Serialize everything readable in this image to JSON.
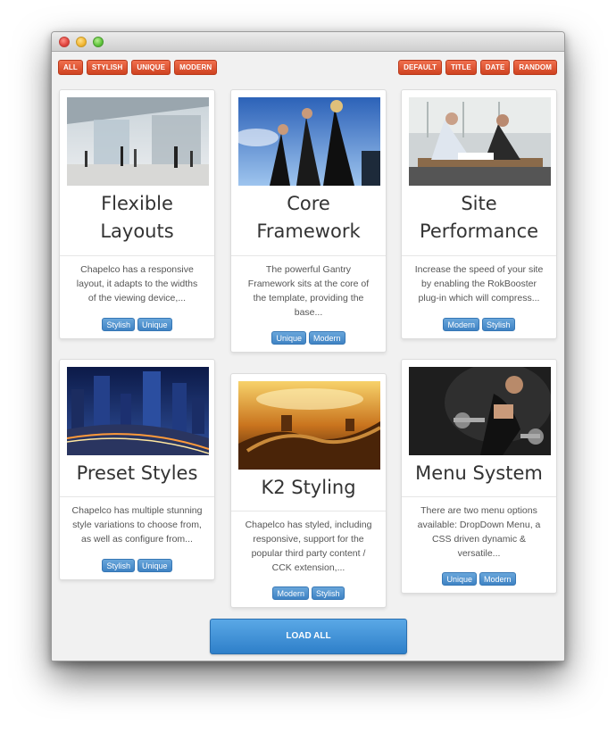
{
  "filters": {
    "categories": [
      "ALL",
      "STYLISH",
      "UNIQUE",
      "MODERN"
    ],
    "sorts": [
      "DEFAULT",
      "TITLE",
      "DATE",
      "RANDOM"
    ]
  },
  "cards": [
    {
      "title": "Flexible Layouts",
      "title_lines": [
        "Flexible",
        "Layouts"
      ],
      "desc_lines": [
        "Chapelco has a responsive",
        "layout, it adapts to the widths",
        "of the viewing device,..."
      ],
      "tags": [
        "Stylish",
        "Unique"
      ],
      "image": "atrium-photo"
    },
    {
      "title": "Core Framework",
      "title_lines": [
        "Core",
        "Framework"
      ],
      "desc_lines": [
        "The powerful Gantry",
        "Framework sits at the core of",
        "the template, providing the",
        "base..."
      ],
      "tags": [
        "Unique",
        "Modern"
      ],
      "image": "business-team-photo"
    },
    {
      "title": "Site Performance",
      "title_lines": [
        "Site",
        "Performance"
      ],
      "desc_lines": [
        "Increase the speed of your site",
        "by enabling the RokBooster",
        "plug-in which will compress..."
      ],
      "tags": [
        "Modern",
        "Stylish"
      ],
      "image": "office-meeting-photo"
    },
    {
      "title": "Preset Styles",
      "title_lines": [
        "Preset Styles"
      ],
      "desc_lines": [
        "Chapelco has multiple stunning",
        "style variations to choose from,",
        "as well as configure from..."
      ],
      "tags": [
        "Stylish",
        "Unique"
      ],
      "image": "city-highway-photo"
    },
    {
      "title": "K2 Styling",
      "title_lines": [
        "K2 Styling"
      ],
      "desc_lines": [
        "Chapelco has styled, including",
        "responsive, support for the",
        "popular third party content /",
        "CCK extension,..."
      ],
      "tags": [
        "Modern",
        "Stylish"
      ],
      "image": "great-wall-photo"
    },
    {
      "title": "Menu System",
      "title_lines": [
        "Menu System"
      ],
      "desc_lines": [
        "There are two menu options",
        "available: DropDown Menu, a",
        "CSS driven dynamic &",
        "versatile..."
      ],
      "tags": [
        "Unique",
        "Modern"
      ],
      "image": "fitness-photo"
    }
  ],
  "load_all_label": "LOAD ALL",
  "colors": {
    "filter_pill": "#dd5530",
    "tag": "#4a8fd0",
    "load_button": "#3a8ad4"
  }
}
